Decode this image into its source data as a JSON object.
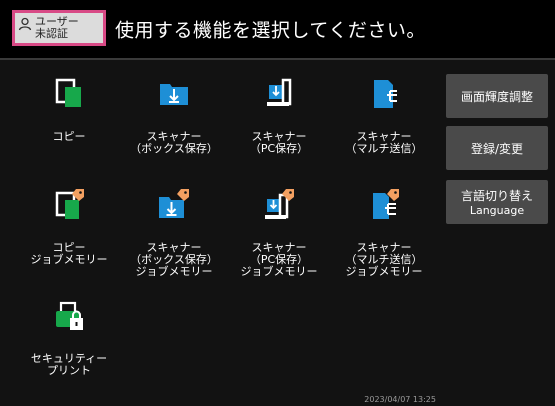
{
  "header": {
    "user_line1": "ユーザー",
    "user_line2": "未認証",
    "title": "使用する機能を選択してください。"
  },
  "functions": [
    {
      "label": "コピー",
      "icon": "copy-icon"
    },
    {
      "label": "スキャナー\n（ボックス保存）",
      "icon": "scan-to-box-icon"
    },
    {
      "label": "スキャナー\n（PC保存）",
      "icon": "scan-to-pc-icon"
    },
    {
      "label": "スキャナー\n（マルチ送信）",
      "icon": "scan-multi-send-icon"
    },
    {
      "label": "コピー\nジョブメモリー",
      "icon": "copy-job-memory-icon"
    },
    {
      "label": "スキャナー\n（ボックス保存）\nジョブメモリー",
      "icon": "scan-to-box-job-memory-icon"
    },
    {
      "label": "スキャナー\n（PC保存）\nジョブメモリー",
      "icon": "scan-to-pc-job-memory-icon"
    },
    {
      "label": "スキャナー\n（マルチ送信）\nジョブメモリー",
      "icon": "scan-multi-send-job-memory-icon"
    },
    {
      "label": "セキュリティー\nプリント",
      "icon": "secure-print-icon"
    }
  ],
  "side_buttons": {
    "brightness": "画面輝度調整",
    "register": "登録/変更",
    "language_line1": "言語切り替え",
    "language_line2": "Language"
  },
  "status": {
    "timestamp": "2023/04/07 13:25"
  },
  "colors": {
    "accent_green": "#17a84b",
    "accent_blue": "#1e8fd6",
    "badge_border": "#d84a86",
    "tag_orange": "#f3a061"
  }
}
